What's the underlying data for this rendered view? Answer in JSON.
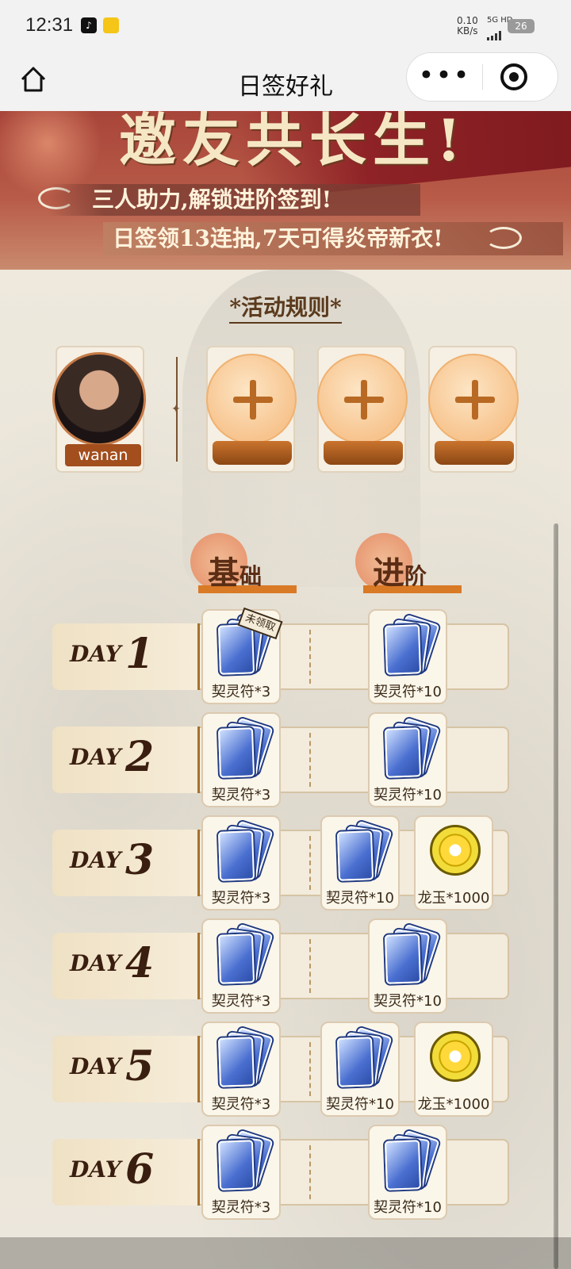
{
  "status_bar": {
    "time": "12:31",
    "net_rate": "0.10",
    "net_unit": "KB/s",
    "network": "5G HD",
    "battery": "26"
  },
  "nav": {
    "title": "日签好礼",
    "more_label": "•••"
  },
  "banner": {
    "title": "邀友共长生!",
    "line1": "三人助力,解锁进阶签到!",
    "line2": "日签领13连抽,7天可得炎帝新衣!"
  },
  "rules_link": "*活动规则*",
  "invite": {
    "user_name": "wanan"
  },
  "tabs": {
    "basic_main": "基",
    "basic_rest": "础",
    "advanced_main": "进",
    "advanced_rest": "阶"
  },
  "stamp_text": "未领取",
  "days": [
    {
      "label": "DAY",
      "num": "1",
      "basic": "契灵符*3",
      "advanced": [
        "契灵符*10"
      ]
    },
    {
      "label": "DAY",
      "num": "2",
      "basic": "契灵符*3",
      "advanced": [
        "契灵符*10"
      ]
    },
    {
      "label": "DAY",
      "num": "3",
      "basic": "契灵符*3",
      "advanced": [
        "契灵符*10",
        "龙玉*1000"
      ]
    },
    {
      "label": "DAY",
      "num": "4",
      "basic": "契灵符*3",
      "advanced": [
        "契灵符*10"
      ]
    },
    {
      "label": "DAY",
      "num": "5",
      "basic": "契灵符*3",
      "advanced": [
        "契灵符*10",
        "龙玉*1000"
      ]
    },
    {
      "label": "DAY",
      "num": "6",
      "basic": "契灵符*3",
      "advanced": [
        "契灵符*10"
      ]
    }
  ]
}
